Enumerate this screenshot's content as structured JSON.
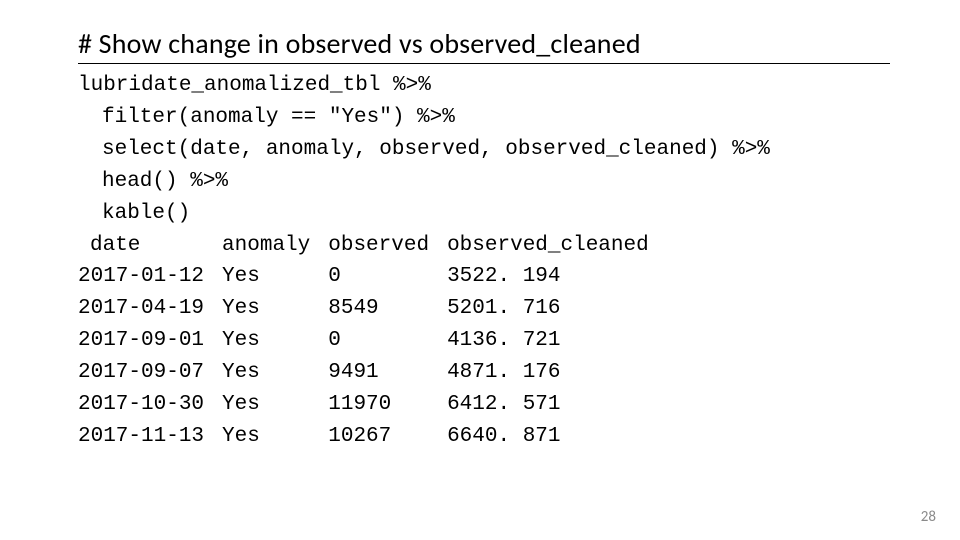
{
  "title": "# Show change in observed vs observed_cleaned",
  "code": {
    "line1": "lubridate_anomalized_tbl %>%",
    "line2": "filter(anomaly == \"Yes\") %>%",
    "line3": "select(date, anomaly, observed, observed_cleaned) %>%",
    "line4": "head() %>%",
    "line5": "kable()"
  },
  "table": {
    "headers": {
      "date": "date",
      "anomaly": "anomaly",
      "observed": "observed",
      "observed_cleaned": "observed_cleaned"
    },
    "rows": [
      {
        "date": "2017-01-12",
        "anomaly": "Yes",
        "observed": "0",
        "observed_cleaned": "3522. 194"
      },
      {
        "date": "2017-04-19",
        "anomaly": "Yes",
        "observed": "8549",
        "observed_cleaned": "5201. 716"
      },
      {
        "date": "2017-09-01",
        "anomaly": "Yes",
        "observed": "0",
        "observed_cleaned": "4136. 721"
      },
      {
        "date": "2017-09-07",
        "anomaly": "Yes",
        "observed": "9491",
        "observed_cleaned": "4871. 176"
      },
      {
        "date": "2017-10-30",
        "anomaly": "Yes",
        "observed": "11970",
        "observed_cleaned": "6412. 571"
      },
      {
        "date": "2017-11-13",
        "anomaly": "Yes",
        "observed": "10267",
        "observed_cleaned": "6640. 871"
      }
    ]
  },
  "page_number": "28",
  "chart_data": {
    "type": "table",
    "title": "Show change in observed vs observed_cleaned",
    "columns": [
      "date",
      "anomaly",
      "observed",
      "observed_cleaned"
    ],
    "rows": [
      [
        "2017-01-12",
        "Yes",
        0,
        3522.194
      ],
      [
        "2017-04-19",
        "Yes",
        8549,
        5201.716
      ],
      [
        "2017-09-01",
        "Yes",
        0,
        4136.721
      ],
      [
        "2017-09-07",
        "Yes",
        9491,
        4871.176
      ],
      [
        "2017-10-30",
        "Yes",
        11970,
        6412.571
      ],
      [
        "2017-11-13",
        "Yes",
        10267,
        6640.871
      ]
    ]
  }
}
